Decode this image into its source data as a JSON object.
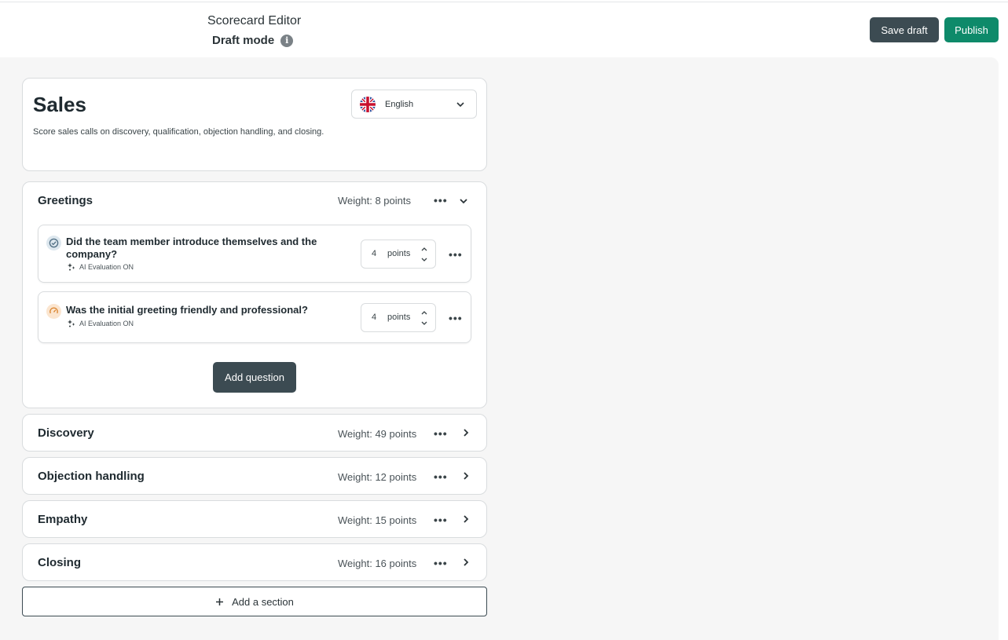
{
  "header": {
    "title": "Scorecard Editor",
    "subtitle": "Draft mode",
    "save_label": "Save draft",
    "publish_label": "Publish"
  },
  "scorecard": {
    "title": "Sales",
    "description": "Score sales calls on discovery, qualification, objection handling, and closing.",
    "language": "English"
  },
  "sections": [
    {
      "title": "Greetings",
      "weight": "Weight: 8 points",
      "expanded": true,
      "questions": [
        {
          "text": "Did the team member introduce themselves and the company?",
          "ai": "AI Evaluation ON",
          "points": "4",
          "unit": "points",
          "icon": "check-circle-icon"
        },
        {
          "text": "Was the initial greeting friendly and professional?",
          "ai": "AI Evaluation ON",
          "points": "4",
          "unit": "points",
          "icon": "gauge-icon"
        }
      ],
      "add_question_label": "Add question"
    },
    {
      "title": "Discovery",
      "weight": "Weight: 49 points",
      "expanded": false
    },
    {
      "title": "Objection handling",
      "weight": "Weight: 12 points",
      "expanded": false
    },
    {
      "title": "Empathy",
      "weight": "Weight: 15 points",
      "expanded": false
    },
    {
      "title": "Closing",
      "weight": "Weight: 16 points",
      "expanded": false
    }
  ],
  "add_section_label": "Add a section",
  "colors": {
    "primary_dark": "#3c4b52",
    "publish_green": "#0e8a6a",
    "canvas_bg": "#f6f6f6"
  }
}
